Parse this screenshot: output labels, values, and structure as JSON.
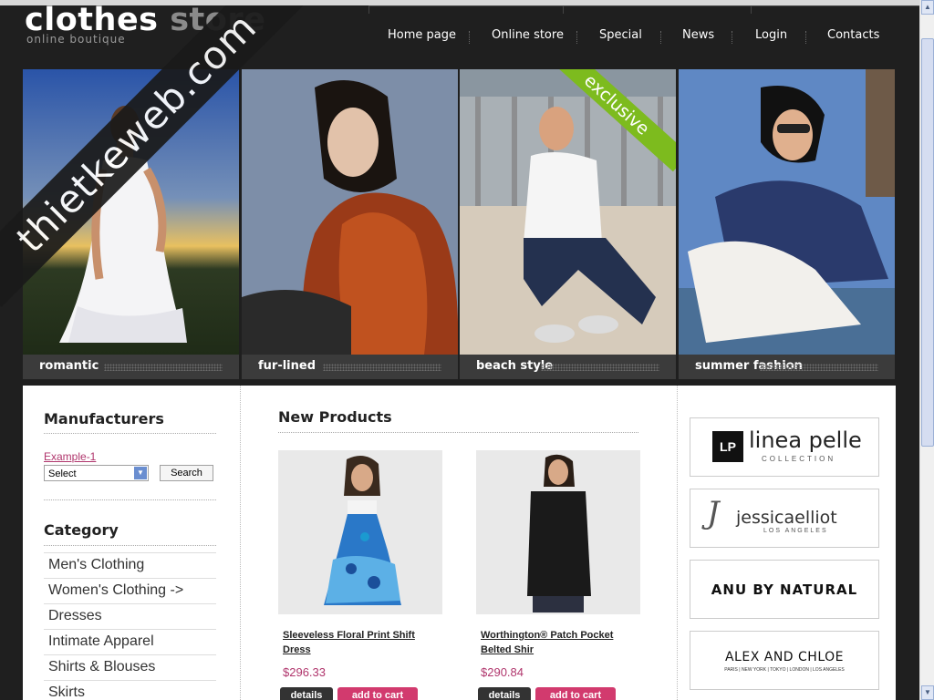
{
  "site": {
    "logo_part1": "clothes ",
    "logo_part2": "store",
    "tagline": "online boutique"
  },
  "nav": [
    "Home page",
    "Online store",
    "Special",
    "News",
    "Login",
    "Contacts"
  ],
  "banner": {
    "badge": "exclusive",
    "panels": [
      "romantic",
      "fur-lined",
      "beach style",
      "summer fashion"
    ]
  },
  "manufacturers": {
    "title": "Manufacturers",
    "link": "Example-1",
    "select_value": "Select",
    "search_label": "Search"
  },
  "category": {
    "title": "Category",
    "items": [
      "Men's Clothing",
      "Women's Clothing ->",
      "Dresses",
      "Intimate Apparel",
      "Shirts & Blouses",
      "Skirts"
    ]
  },
  "new_products": {
    "title": "New Products",
    "items": [
      {
        "name": "Sleeveless Floral Print Shift Dress",
        "price": "$296.33",
        "details": "details",
        "cart": "add to cart"
      },
      {
        "name": "Worthington® Patch Pocket Belted Shir",
        "price": "$290.84",
        "details": "details",
        "cart": "add to cart"
      }
    ]
  },
  "brands": {
    "linea_main": "linea pelle",
    "linea_sub": "COLLECTION",
    "linea_mark": "LP",
    "jessica_main": "jessicaelliot",
    "jessica_sub": "LOS ANGELES",
    "jessica_mark": "J",
    "anu": "ANU BY NATURAL",
    "alex_main": "ALEX AND CHLOE",
    "alex_sub": "PARIS | NEW YORK | TOKYO | LONDON | LOS ANGELES"
  },
  "watermark": "thietkeweb.com",
  "colors": {
    "accent": "#d23a6e",
    "badge_green": "#7dbb1e",
    "price": "#b0356c",
    "dark_bg": "#1f1f1f"
  }
}
